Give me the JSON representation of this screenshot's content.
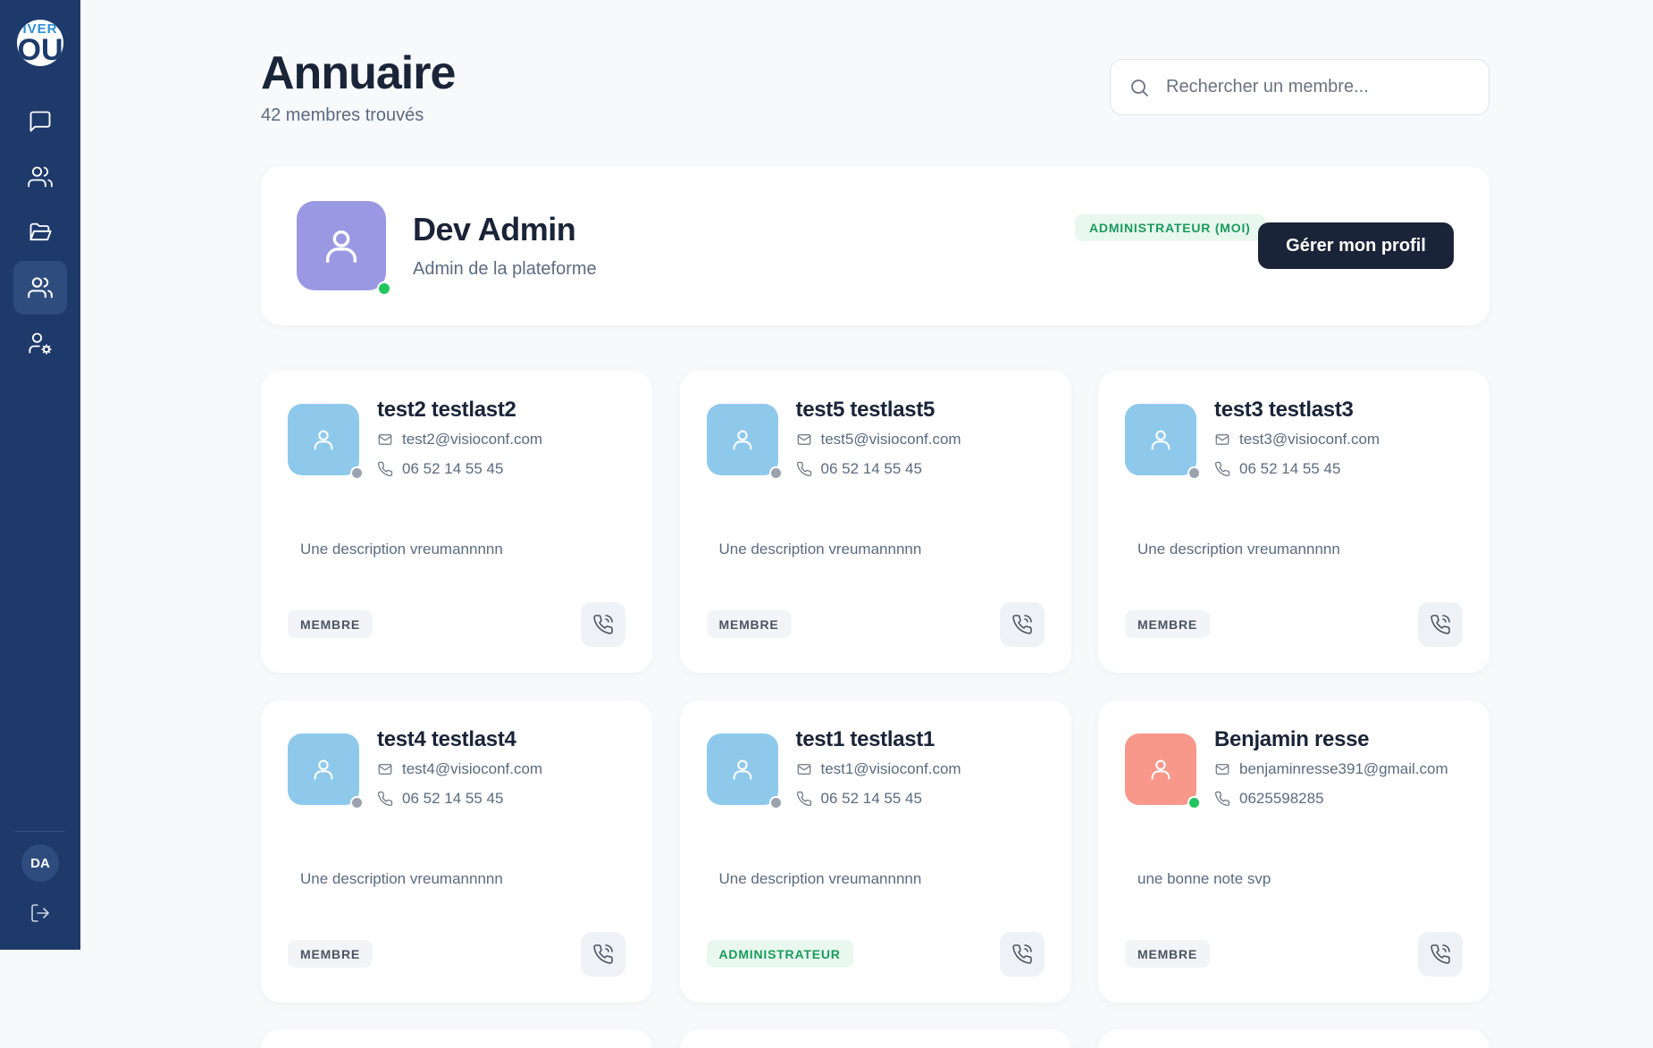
{
  "sidebar": {
    "logo": {
      "top": "IVER",
      "bottom": "OU"
    },
    "nav": [
      {
        "name": "messages",
        "icon": "message-square-icon"
      },
      {
        "name": "teams",
        "icon": "users-icon"
      },
      {
        "name": "files",
        "icon": "folder-icon"
      },
      {
        "name": "directory",
        "icon": "users-icon",
        "active": true
      },
      {
        "name": "admin",
        "icon": "user-cog-icon"
      }
    ],
    "user_initials": "DA",
    "logout_icon": "logout-icon"
  },
  "header": {
    "title": "Annuaire",
    "subtitle": "42 membres trouvés"
  },
  "search": {
    "placeholder": "Rechercher un membre...",
    "value": ""
  },
  "profile": {
    "name": "Dev Admin",
    "role": "Admin de la plateforme",
    "badge": "ADMINISTRATEUR (MOI)",
    "button": "Gérer mon profil",
    "avatar_color": "#9b98e3",
    "status": "online"
  },
  "members": [
    {
      "name": "test2 testlast2",
      "email": "test2@visioconf.com",
      "phone": "06 52 14 55 45",
      "description": "Une description vreumannnnn",
      "role": "MEMBRE",
      "role_type": "member",
      "avatar_color": "#8ec9ec",
      "status": "offline"
    },
    {
      "name": "test5 testlast5",
      "email": "test5@visioconf.com",
      "phone": "06 52 14 55 45",
      "description": "Une description vreumannnnn",
      "role": "MEMBRE",
      "role_type": "member",
      "avatar_color": "#8ec9ec",
      "status": "offline"
    },
    {
      "name": "test3 testlast3",
      "email": "test3@visioconf.com",
      "phone": "06 52 14 55 45",
      "description": "Une description vreumannnnn",
      "role": "MEMBRE",
      "role_type": "member",
      "avatar_color": "#8ec9ec",
      "status": "offline"
    },
    {
      "name": "test4 testlast4",
      "email": "test4@visioconf.com",
      "phone": "06 52 14 55 45",
      "description": "Une description vreumannnnn",
      "role": "MEMBRE",
      "role_type": "member",
      "avatar_color": "#8ec9ec",
      "status": "offline"
    },
    {
      "name": "test1 testlast1",
      "email": "test1@visioconf.com",
      "phone": "06 52 14 55 45",
      "description": "Une description vreumannnnn",
      "role": "ADMINISTRATEUR",
      "role_type": "admin",
      "avatar_color": "#8ec9ec",
      "status": "offline"
    },
    {
      "name": "Benjamin resse",
      "email": "benjaminresse391@gmail.com",
      "phone": "0625598285",
      "description": "une bonne note svp",
      "role": "MEMBRE",
      "role_type": "member",
      "avatar_color": "#f7988a",
      "status": "online"
    }
  ],
  "colors": {
    "sidebar": "#1d3a6b",
    "online": "#22c55e",
    "offline": "#9ca3af",
    "primary_button": "#1a2438"
  }
}
